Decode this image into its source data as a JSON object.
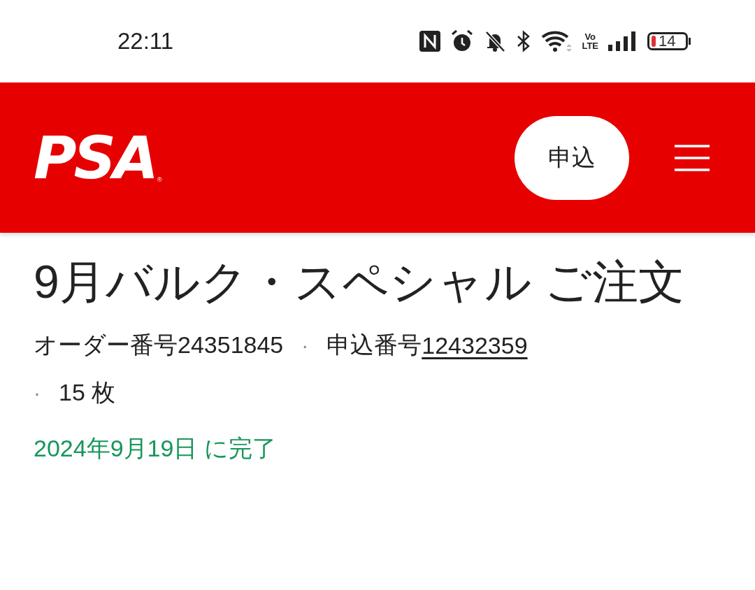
{
  "status_bar": {
    "time": "22:11",
    "volte": [
      "Vo",
      "LTE"
    ],
    "battery": "14"
  },
  "header": {
    "logo": "PSA",
    "logo_mark": "®",
    "apply_button": "申込"
  },
  "order": {
    "title": "9月バルク・スペシャル ご注文",
    "order_text": "オーダー番号24351845",
    "separators": [
      "·",
      "·"
    ],
    "application_label": "申込番号",
    "application_number": "12432359",
    "count": "15 枚",
    "completed": "2024年9月19日 に完了"
  }
}
